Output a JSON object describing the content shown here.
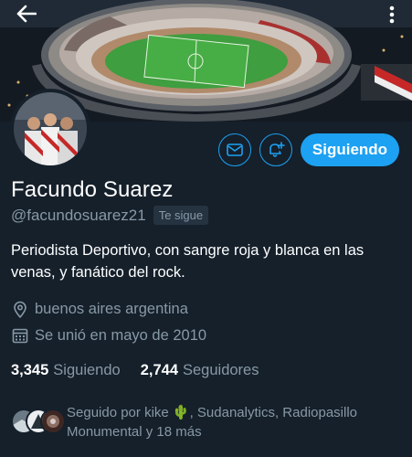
{
  "profile": {
    "name": "Facundo Suarez",
    "handle": "@facundosuarez21",
    "follows_you": "Te sigue",
    "bio": "Periodista Deportivo, con sangre roja y blanca en las venas, y fanático del rock.",
    "location": "buenos aires argentina",
    "joined": "Se unió en mayo de 2010"
  },
  "actions": {
    "follow_label": "Siguiendo"
  },
  "stats": {
    "following_count": "3,345",
    "following_label": "Siguiendo",
    "followers_count": "2,744",
    "followers_label": "Seguidores"
  },
  "followed_by": {
    "text": "Seguido por kike 🌵, Sudanalytics, Radiopasillo Monumental y 18 más"
  },
  "icons": {
    "back": "arrow-left-icon",
    "more": "more-vertical-icon",
    "message": "mail-icon",
    "notifications": "bell-plus-icon",
    "location": "location-pin-icon",
    "calendar": "calendar-icon"
  },
  "colors": {
    "background": "#15202b",
    "accent": "#1da1f2",
    "secondary_text": "#8899a6",
    "primary_text": "#ffffff"
  }
}
